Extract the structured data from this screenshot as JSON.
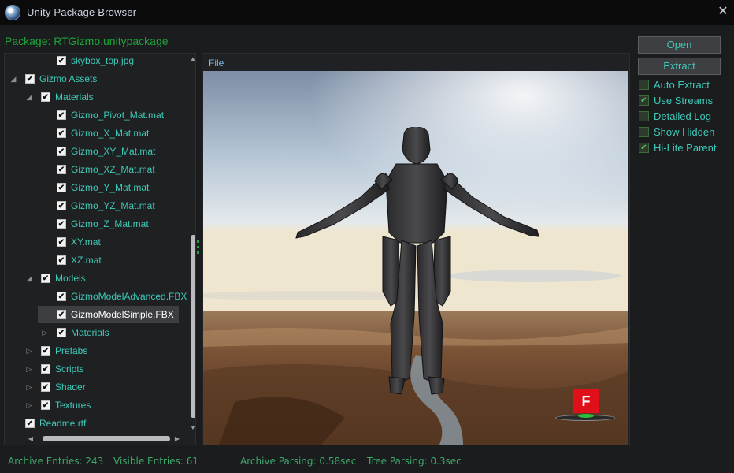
{
  "window": {
    "title": "Unity Package Browser",
    "minimize_glyph": "—",
    "close_glyph": "✕"
  },
  "package": {
    "label": "Package: RTGizmo.unitypackage"
  },
  "preview": {
    "menu_file": "File",
    "overlay_badge": "F"
  },
  "tree": {
    "items": [
      {
        "label": "skybox_top.jpg",
        "level": 2,
        "expander": "none",
        "checked": true,
        "selected": false
      },
      {
        "label": "Gizmo Assets",
        "level": 0,
        "expander": "expanded",
        "checked": true,
        "selected": false
      },
      {
        "label": "Materials",
        "level": 1,
        "expander": "expanded",
        "checked": true,
        "selected": false
      },
      {
        "label": "Gizmo_Pivot_Mat.mat",
        "level": 2,
        "expander": "none",
        "checked": true,
        "selected": false
      },
      {
        "label": "Gizmo_X_Mat.mat",
        "level": 2,
        "expander": "none",
        "checked": true,
        "selected": false
      },
      {
        "label": "Gizmo_XY_Mat.mat",
        "level": 2,
        "expander": "none",
        "checked": true,
        "selected": false
      },
      {
        "label": "Gizmo_XZ_Mat.mat",
        "level": 2,
        "expander": "none",
        "checked": true,
        "selected": false
      },
      {
        "label": "Gizmo_Y_Mat.mat",
        "level": 2,
        "expander": "none",
        "checked": true,
        "selected": false
      },
      {
        "label": "Gizmo_YZ_Mat.mat",
        "level": 2,
        "expander": "none",
        "checked": true,
        "selected": false
      },
      {
        "label": "Gizmo_Z_Mat.mat",
        "level": 2,
        "expander": "none",
        "checked": true,
        "selected": false
      },
      {
        "label": "XY.mat",
        "level": 2,
        "expander": "none",
        "checked": true,
        "selected": false
      },
      {
        "label": "XZ.mat",
        "level": 2,
        "expander": "none",
        "checked": true,
        "selected": false
      },
      {
        "label": "Models",
        "level": 1,
        "expander": "expanded",
        "checked": true,
        "selected": false
      },
      {
        "label": "GizmoModelAdvanced.FBX",
        "level": 2,
        "expander": "none",
        "checked": true,
        "selected": false
      },
      {
        "label": "GizmoModelSimple.FBX",
        "level": 2,
        "expander": "none",
        "checked": true,
        "selected": true
      },
      {
        "label": "Materials",
        "level": 2,
        "expander": "collapsed",
        "checked": true,
        "selected": false
      },
      {
        "label": "Prefabs",
        "level": 1,
        "expander": "collapsed",
        "checked": true,
        "selected": false
      },
      {
        "label": "Scripts",
        "level": 1,
        "expander": "collapsed",
        "checked": true,
        "selected": false
      },
      {
        "label": "Shader",
        "level": 1,
        "expander": "collapsed",
        "checked": true,
        "selected": false
      },
      {
        "label": "Textures",
        "level": 1,
        "expander": "collapsed",
        "checked": true,
        "selected": false
      },
      {
        "label": "Readme.rtf",
        "level": 0,
        "expander": "none",
        "checked": true,
        "selected": false
      }
    ]
  },
  "buttons": {
    "open": "Open",
    "extract": "Extract"
  },
  "options": [
    {
      "label": "Auto Extract",
      "checked": false
    },
    {
      "label": "Use Streams",
      "checked": true
    },
    {
      "label": "Detailed Log",
      "checked": false
    },
    {
      "label": "Show Hidden",
      "checked": false
    },
    {
      "label": "Hi-Lite Parent",
      "checked": true
    }
  ],
  "status": {
    "archive_entries": "Archive Entries: 243",
    "visible_entries": "Visible Entries: 61",
    "archive_parsing": "Archive Parsing: 0.58sec",
    "tree_parsing": "Tree Parsing: 0.3sec"
  },
  "colors": {
    "accent_teal": "#3ec9b8",
    "package_green": "#1ea43a",
    "status_green": "#3ea86a",
    "badge_red": "#e0101a"
  }
}
